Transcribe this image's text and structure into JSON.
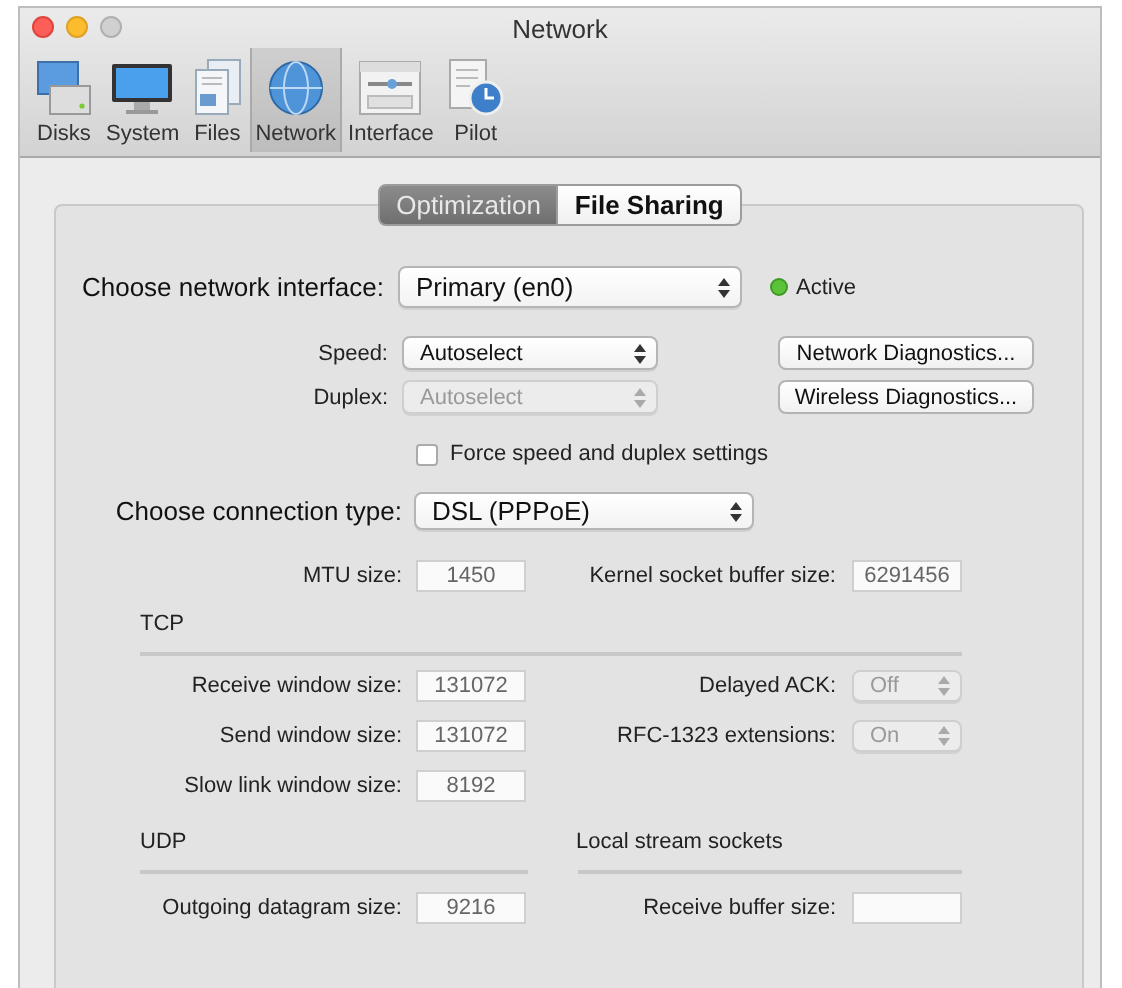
{
  "window": {
    "title": "Network",
    "buttons": [
      {
        "kind": "close",
        "enabled": true
      },
      {
        "kind": "minimize",
        "enabled": true
      },
      {
        "kind": "zoom",
        "enabled": false
      }
    ]
  },
  "toolbar": [
    {
      "kind": "disks",
      "label": "Disks",
      "selected": false
    },
    {
      "kind": "system",
      "label": "System",
      "selected": false
    },
    {
      "kind": "files",
      "label": "Files",
      "selected": false
    },
    {
      "kind": "network",
      "label": "Network",
      "selected": true
    },
    {
      "kind": "interface",
      "label": "Interface",
      "selected": false
    },
    {
      "kind": "pilot",
      "label": "Pilot",
      "selected": false
    }
  ],
  "tabs": [
    {
      "label": "Optimization",
      "selected": true
    },
    {
      "label": "File Sharing",
      "selected": false
    }
  ],
  "interface": {
    "label": "Choose network interface:",
    "value": "Primary (en0)",
    "status": {
      "label": "Active",
      "on": true
    }
  },
  "speed": {
    "label": "Speed:",
    "value": "Autoselect",
    "disabled": false
  },
  "duplex": {
    "label": "Duplex:",
    "value": "Autoselect",
    "disabled": true
  },
  "buttons": [
    "Network Diagnostics...",
    "Wireless Diagnostics..."
  ],
  "force_checkbox": {
    "label": "Force speed and duplex settings",
    "checked": false
  },
  "connection": {
    "label": "Choose connection type:",
    "value": "DSL (PPPoE)"
  },
  "mtu": {
    "label": "MTU size:",
    "value": "1450"
  },
  "kernel_buffer": {
    "label": "Kernel socket buffer size:",
    "value": "6291456"
  },
  "tcp": {
    "title": "TCP",
    "rows": [
      {
        "label": "Receive window size:",
        "value": "131072",
        "option": {
          "label": "Delayed ACK:",
          "value": "Off",
          "disabled": true
        }
      },
      {
        "label": "Send window size:",
        "value": "131072",
        "option": {
          "label": "RFC-1323 extensions:",
          "value": "On",
          "disabled": true
        }
      },
      {
        "label": "Slow link window size:",
        "value": "8192"
      }
    ]
  },
  "udp": {
    "title": "UDP",
    "rows": [
      {
        "label": "Outgoing datagram size:",
        "value": "9216"
      }
    ]
  },
  "local_stream_sockets": {
    "title": "Local stream sockets",
    "rows": [
      {
        "label": "Receive buffer size:"
      }
    ]
  }
}
